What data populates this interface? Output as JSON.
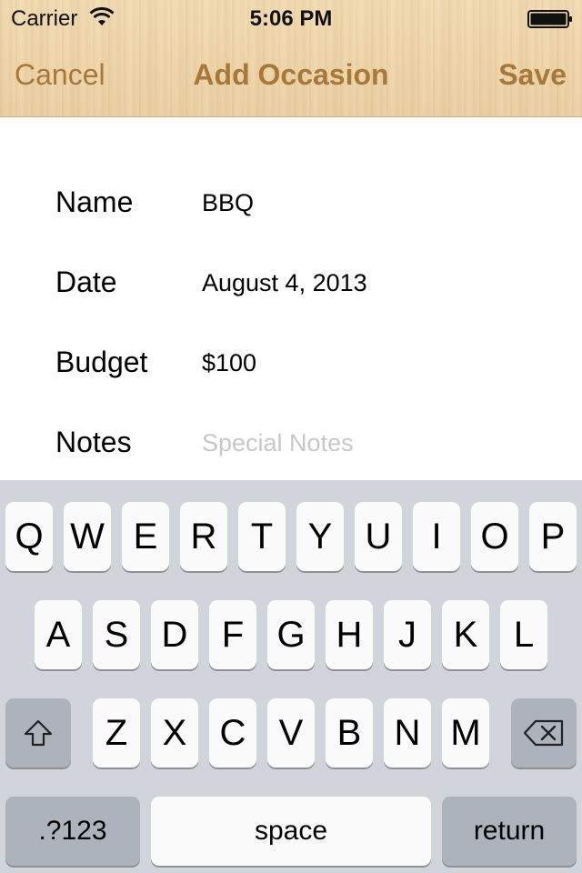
{
  "status_bar": {
    "carrier": "Carrier",
    "time": "5:06 PM",
    "wifi_icon": "wifi-icon",
    "battery_icon": "battery-icon"
  },
  "nav": {
    "cancel_label": "Cancel",
    "title": "Add Occasion",
    "save_label": "Save",
    "accent_color": "#a8783a"
  },
  "form": {
    "name": {
      "label": "Name",
      "value": "BBQ"
    },
    "date": {
      "label": "Date",
      "value": "August 4, 2013"
    },
    "budget": {
      "label": "Budget",
      "value": "$100"
    },
    "notes": {
      "label": "Notes",
      "value": "",
      "placeholder": "Special Notes"
    }
  },
  "keyboard": {
    "row1": [
      "Q",
      "W",
      "E",
      "R",
      "T",
      "Y",
      "U",
      "I",
      "O",
      "P"
    ],
    "row2": [
      "A",
      "S",
      "D",
      "F",
      "G",
      "H",
      "J",
      "K",
      "L"
    ],
    "row3": [
      "Z",
      "X",
      "C",
      "V",
      "B",
      "N",
      "M"
    ],
    "shift_icon": "shift-icon",
    "delete_icon": "delete-icon",
    "numbers_label": ".?123",
    "space_label": "space",
    "return_label": "return"
  }
}
